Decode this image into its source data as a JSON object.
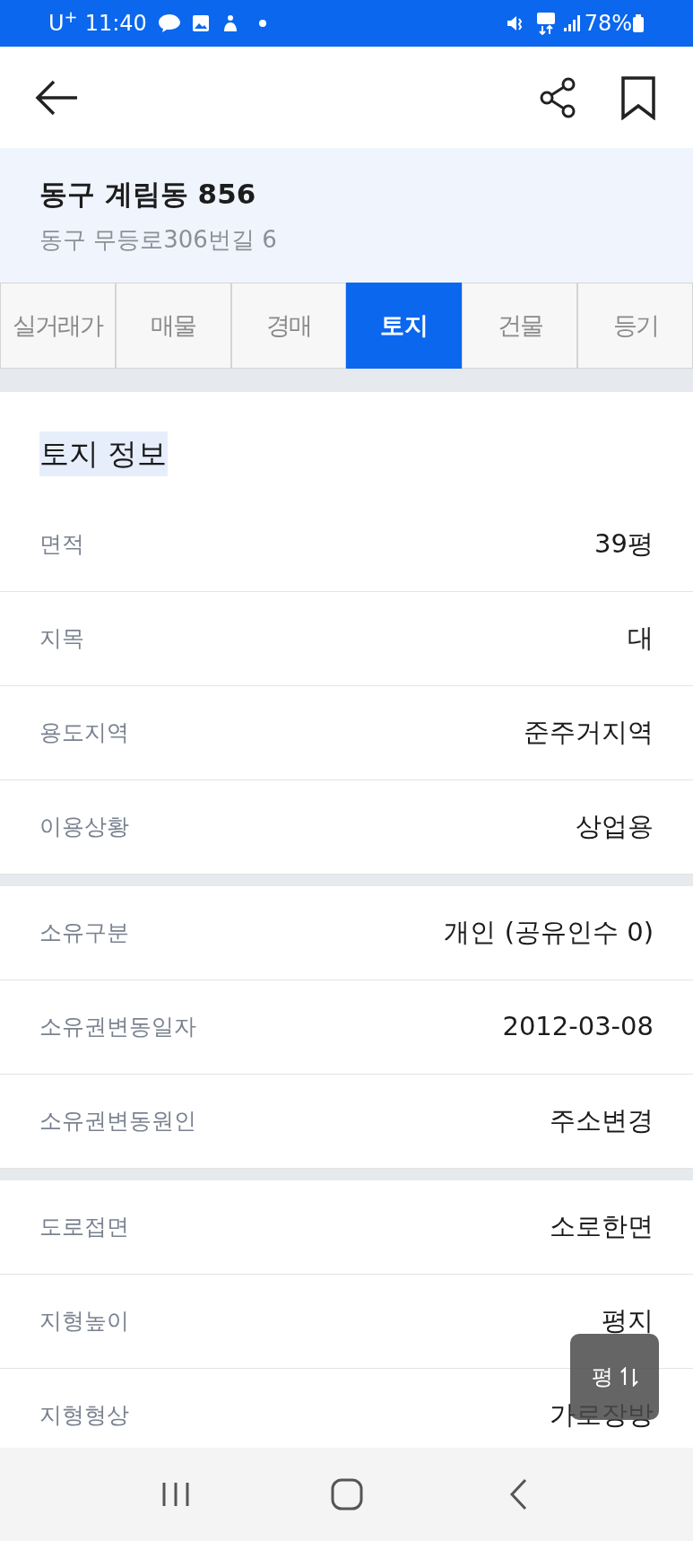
{
  "status_bar": {
    "carrier": "U$^{+}$",
    "time": "11:40",
    "battery": "78%"
  },
  "place": {
    "title": "동구 계림동 856",
    "address": "동구 무등로306번길 6"
  },
  "tabs": [
    {
      "label": "실거래가",
      "selected": false
    },
    {
      "label": "매물",
      "selected": false
    },
    {
      "label": "경매",
      "selected": false
    },
    {
      "label": "토지",
      "selected": true
    },
    {
      "label": "건물",
      "selected": false
    },
    {
      "label": "등기",
      "selected": false
    }
  ],
  "section": {
    "title": "토지 정보"
  },
  "groups": [
    {
      "rows": [
        {
          "label": "면적",
          "value": "39평"
        },
        {
          "label": "지목",
          "value": "대"
        },
        {
          "label": "용도지역",
          "value": "준주거지역"
        },
        {
          "label": "이용상황",
          "value": "상업용"
        }
      ]
    },
    {
      "rows": [
        {
          "label": "소유구분",
          "value": "개인 (공유인수 0)"
        },
        {
          "label": "소유권변동일자",
          "value": "2012-03-08"
        },
        {
          "label": "소유권변동원인",
          "value": "주소변경"
        }
      ]
    },
    {
      "rows": [
        {
          "label": "도로접면",
          "value": "소로한면"
        },
        {
          "label": "지형높이",
          "value": "평지"
        },
        {
          "label": "지형형상",
          "value": "가로장방"
        }
      ]
    }
  ],
  "unit_toggle": {
    "label": "평"
  }
}
